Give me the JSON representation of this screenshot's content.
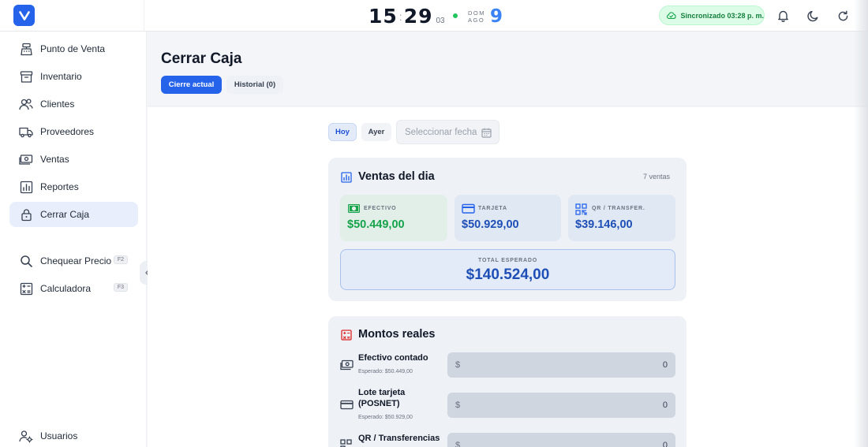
{
  "topbar": {
    "logo_letter": "V",
    "clock": {
      "hours": "15",
      "minutes": "29",
      "seconds": "03"
    },
    "date": {
      "dow": "DOM",
      "month": "AGO",
      "day": "9"
    },
    "sync_label": "Sincronizado 03:28 p. m."
  },
  "sidebar": {
    "items": [
      {
        "label": "Punto de Venta",
        "icon": "cash-register-icon"
      },
      {
        "label": "Inventario",
        "icon": "archive-box-icon"
      },
      {
        "label": "Clientes",
        "icon": "users-icon"
      },
      {
        "label": "Proveedores",
        "icon": "truck-icon"
      },
      {
        "label": "Ventas",
        "icon": "banknote-icon"
      },
      {
        "label": "Reportes",
        "icon": "chart-icon"
      },
      {
        "label": "Cerrar Caja",
        "icon": "lock-icon",
        "active": true
      }
    ],
    "tools": [
      {
        "label": "Chequear Precio",
        "shortcut": "F2",
        "icon": "search-icon"
      },
      {
        "label": "Calculadora",
        "shortcut": "F3",
        "icon": "calculator-icon"
      }
    ],
    "footer": {
      "label": "Usuarios",
      "icon": "users-gear-icon"
    }
  },
  "page": {
    "title": "Cerrar Caja",
    "tabs": [
      {
        "label": "Cierre actual",
        "active": true
      },
      {
        "label": "Historial (0)",
        "active": false
      }
    ]
  },
  "filters": {
    "today": "Hoy",
    "yesterday": "Ayer",
    "date_placeholder": "Seleccionar fecha"
  },
  "sales": {
    "title": "Ventas del dia",
    "count": "7 ventas",
    "cash": {
      "label": "EFECTIVO",
      "value": "$50.449,00"
    },
    "card": {
      "label": "TARJETA",
      "value": "$50.929,00"
    },
    "qr": {
      "label": "QR / TRANSFER.",
      "value": "$39.146,00"
    },
    "total": {
      "label": "TOTAL ESPERADO",
      "value": "$140.524,00"
    }
  },
  "actual": {
    "title": "Montos reales",
    "currency": "$",
    "rows": [
      {
        "label": "Efectivo contado",
        "expected": "Esperado: $50.449,00",
        "value": "0"
      },
      {
        "label": "Lote tarjeta (POSNET)",
        "expected": "Esperado: $50.929,00",
        "value": "0"
      },
      {
        "label": "QR / Transferencias",
        "expected": "",
        "value": "0"
      }
    ]
  },
  "colors": {
    "primary": "#2563eb",
    "success": "#15803d",
    "danger": "#dc2626"
  }
}
